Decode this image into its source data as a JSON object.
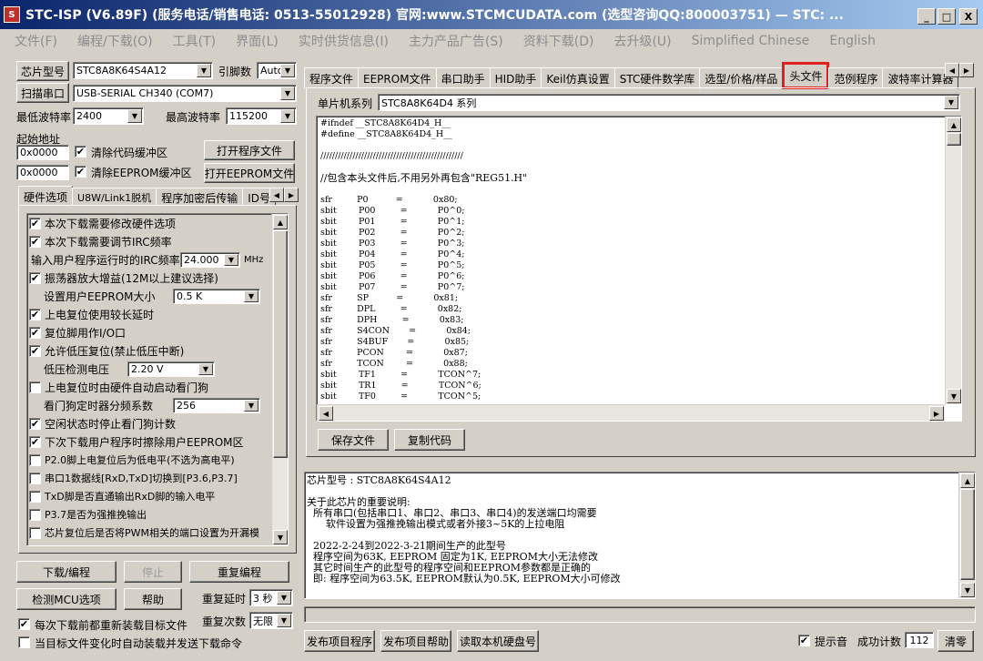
{
  "window": {
    "title": "STC-ISP (V6.89F) (服务电话/销售电话: 0513-55012928) 官网:www.STCMCUDATA.com  (选型咨询QQ:800003751) — STC: ...",
    "min": "_",
    "max": "□",
    "close": "X"
  },
  "menu": [
    "文件(F)",
    "编程/下载(O)",
    "工具(T)",
    "界面(L)",
    "实时供货信息(I)",
    "主力产品广告(S)",
    "资料下载(D)",
    "去升级(U)",
    "Simplified Chinese",
    "English"
  ],
  "left": {
    "chip_type_btn": "芯片型号",
    "chip_type_val": "STC8A8K64S4A12",
    "pin_label": "引脚数",
    "pin_val": "Auto",
    "scan_port_btn": "扫描串口",
    "port_val": "USB-SERIAL CH340 (COM7)",
    "min_baud_label": "最低波特率",
    "min_baud_val": "2400",
    "max_baud_label": "最高波特率",
    "max_baud_val": "115200",
    "start_addr_label": "起始地址",
    "addr1": "0x0000",
    "clear_code": "清除代码缓冲区",
    "open_prog": "打开程序文件",
    "addr2": "0x0000",
    "clear_eeprom": "清除EEPROM缓冲区",
    "open_eeprom": "打开EEPROM文件",
    "tabs": [
      "硬件选项",
      "U8W/Link1脱机",
      "程序加密后传输",
      "ID号"
    ],
    "opts": [
      {
        "label": "本次下载需要修改硬件选项",
        "checked": true
      },
      {
        "label": "本次下载需要调节IRC频率",
        "checked": true
      },
      {
        "label": "输入用户程序运行时的IRC频率",
        "checked": null,
        "value": "24.000",
        "unit": "MHz"
      },
      {
        "label": "振荡器放大增益(12M以上建议选择)",
        "checked": true
      },
      {
        "label": "设置用户EEPROM大小",
        "checked": null,
        "value": "0.5 K"
      },
      {
        "label": "上电复位使用较长延时",
        "checked": true
      },
      {
        "label": "复位脚用作I/O口",
        "checked": true
      },
      {
        "label": "允许低压复位(禁止低压中断)",
        "checked": true
      },
      {
        "label": "低压检测电压",
        "checked": null,
        "value": "2.20 V"
      },
      {
        "label": "上电复位时由硬件自动启动看门狗",
        "checked": false
      },
      {
        "label": "看门狗定时器分频系数",
        "checked": null,
        "value": "256"
      },
      {
        "label": "空闲状态时停止看门狗计数",
        "checked": true
      },
      {
        "label": "下次下载用户程序时擦除用户EEPROM区",
        "checked": true
      },
      {
        "label": "P2.0脚上电复位后为低电平(不选为高电平)",
        "checked": false
      },
      {
        "label": "串口1数据线[RxD,TxD]切换到[P3.6,P3.7]",
        "checked": false
      },
      {
        "label": "TxD脚是否直通输出RxD脚的输入电平",
        "checked": false
      },
      {
        "label": "P3.7是否为强推挽输出",
        "checked": false
      },
      {
        "label": "芯片复位后是否将PWM相关的端口设置为开漏模",
        "checked": false
      }
    ],
    "download_btn": "下载/编程",
    "stop_btn": "停止",
    "reprogram_btn": "重复编程",
    "check_mcu_btn": "检测MCU选项",
    "help_btn": "帮助",
    "repeat_delay_label": "重复延时",
    "repeat_delay_val": "3 秒",
    "reload_label": "每次下载前都重新装载目标文件",
    "repeat_count_label": "重复次数",
    "repeat_count_val": "无限",
    "auto_send_label": "当目标文件变化时自动装载并发送下载命令"
  },
  "right": {
    "tabs": [
      "程序文件",
      "EEPROM文件",
      "串口助手",
      "HID助手",
      "Keil仿真设置",
      "STC硬件数学库",
      "选型/价格/样品",
      "头文件",
      "范例程序",
      "波特率计算器"
    ],
    "series_label": "单片机系列",
    "series_val": "STC8A8K64D4 系列",
    "code_lines": [
      "#ifndef __STC8A8K64D4_H__",
      "#define __STC8A8K64D4_H__",
      "",
      "/////////////////////////////////////////////////",
      "",
      "//包含本头文件后,不用另外再包含\"REG51.H\"",
      "",
      "sfr         P0          =           0x80;",
      "sbit        P00         =           P0^0;",
      "sbit        P01         =           P0^1;",
      "sbit        P02         =           P0^2;",
      "sbit        P03         =           P0^3;",
      "sbit        P04         =           P0^4;",
      "sbit        P05         =           P0^5;",
      "sbit        P06         =           P0^6;",
      "sbit        P07         =           P0^7;",
      "sfr         SP          =           0x81;",
      "sfr         DPL         =           0x82;",
      "sfr         DPH         =           0x83;",
      "sfr         S4CON       =           0x84;",
      "sfr         S4BUF       =           0x85;",
      "sfr         PCON        =           0x87;",
      "sfr         TCON        =           0x88;",
      "sbit        TF1         =           TCON^7;",
      "sbit        TR1         =           TCON^6;",
      "sbit        TF0         =           TCON^5;"
    ],
    "save_btn": "保存文件",
    "copy_btn": "复制代码",
    "info_lines": [
      "芯片型号 : STC8A8K64S4A12",
      "",
      "关于此芯片的重要说明:",
      "  所有串口(包括串口1、串口2、串口3、串口4)的发送端口均需要",
      "      软件设置为强推挽输出模式或者外接3~5K的上拉电阻",
      "",
      "  2022-2-24到2022-3-21期间生产的此型号",
      "  程序空间为63K, EEPROM 固定为1K, EEPROM大小无法修改",
      "  其它时间生产的此型号的程序空间和EEPROM参数都是正确的",
      "  即: 程序空间为63.5K, EEPROM默认为0.5K, EEPROM大小可修改"
    ],
    "publish_prog": "发布项目程序",
    "publish_help": "发布项目帮助",
    "read_disk": "读取本机硬盘号",
    "sound_label": "提示音",
    "success_label": "成功计数",
    "success_val": "112",
    "clear_btn": "清零"
  }
}
